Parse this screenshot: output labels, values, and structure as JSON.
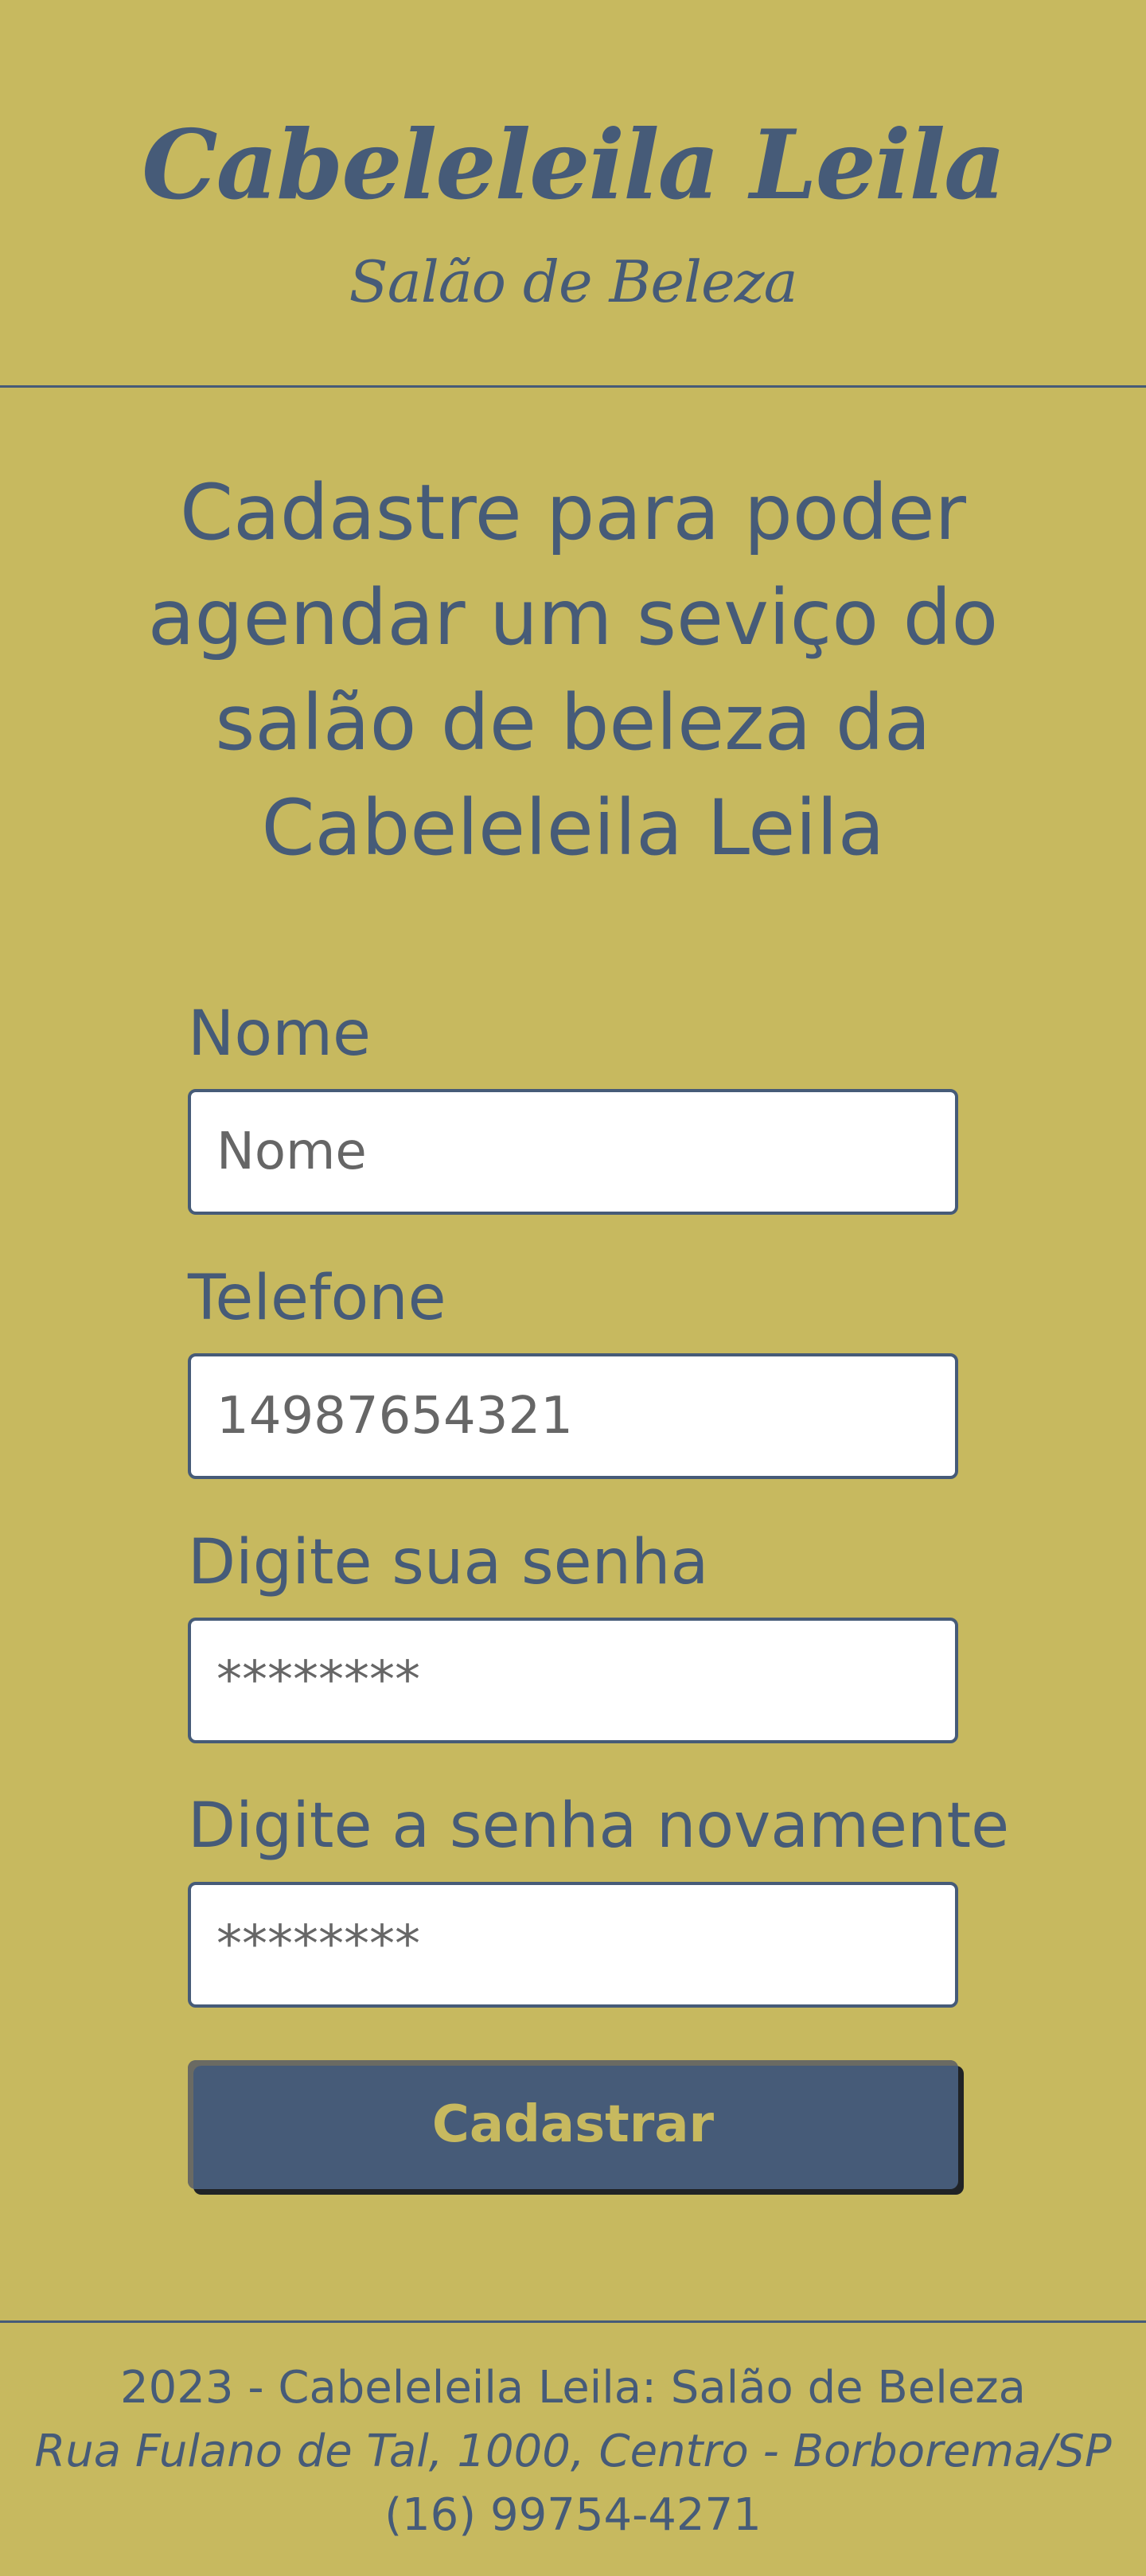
{
  "header": {
    "title": "Cabeleleila Leila",
    "subtitle": "Salão de Beleza"
  },
  "intro": "Cadastre para poder agendar um seviço do salão de beleza da Cabeleleila Leila",
  "form": {
    "fields": [
      {
        "label": "Nome",
        "placeholder": "Nome",
        "value": ""
      },
      {
        "label": "Telefone",
        "placeholder": "14987654321",
        "value": ""
      },
      {
        "label": "Digite sua senha",
        "placeholder": "********",
        "value": ""
      },
      {
        "label": "Digite a senha novamente",
        "placeholder": "********",
        "value": ""
      }
    ],
    "submit_label": "Cadastrar"
  },
  "footer": {
    "copyright": "2023 - Cabeleleila Leila: Salão de Beleza",
    "address": "Rua Fulano de Tal, 1000, Centro - Borborema/SP",
    "phone": "(16) 99754-4271"
  },
  "colors": {
    "background": "#c7b95f",
    "text": "#465b78",
    "input_background": "#ffffff",
    "button_background": "#465b78",
    "button_text": "#c7b95f"
  }
}
